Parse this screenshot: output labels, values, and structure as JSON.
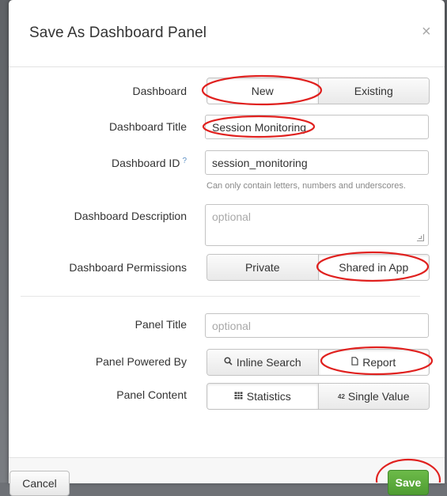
{
  "dialog": {
    "title": "Save As Dashboard Panel",
    "close_icon": "close-icon"
  },
  "form": {
    "dashboard": {
      "label": "Dashboard",
      "options": [
        "New",
        "Existing"
      ],
      "selected": "New"
    },
    "dashboard_title": {
      "label": "Dashboard Title",
      "value": "Session Monitoring"
    },
    "dashboard_id": {
      "label": "Dashboard ID",
      "help_mark": "?",
      "value": "session_monitoring",
      "help_text": "Can only contain letters, numbers and underscores."
    },
    "dashboard_description": {
      "label": "Dashboard Description",
      "placeholder": "optional"
    },
    "dashboard_permissions": {
      "label": "Dashboard Permissions",
      "options": [
        "Private",
        "Shared in App"
      ],
      "selected": "Shared in App"
    },
    "panel_title": {
      "label": "Panel Title",
      "placeholder": "optional"
    },
    "panel_powered_by": {
      "label": "Panel Powered By",
      "options": [
        "Inline Search",
        "Report"
      ],
      "icons": [
        "search-icon",
        "report-icon"
      ],
      "selected": "Report"
    },
    "panel_content": {
      "label": "Panel Content",
      "options": [
        "Statistics",
        "Single Value"
      ],
      "icons": [
        "table-icon",
        "single-value-icon"
      ],
      "icon_text": [
        "",
        "42"
      ]
    }
  },
  "footer": {
    "cancel_label": "Cancel",
    "save_label": "Save",
    "save_color": "#5aab3b"
  },
  "annotation_color": "#e0211f"
}
